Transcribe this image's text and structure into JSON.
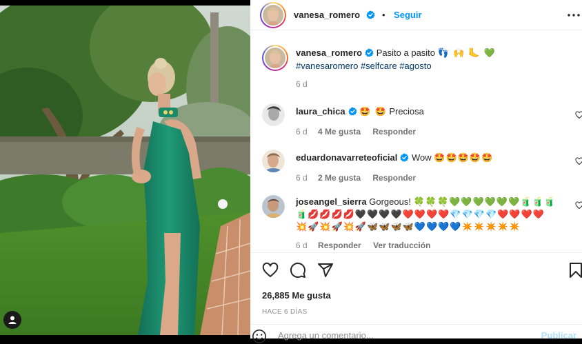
{
  "post": {
    "author": "vanesa_romero",
    "follow_label": "Seguir",
    "dot": "•",
    "caption_text": "Pasito a pasito",
    "caption_emojis": "👣 🙌 🦶 💚",
    "hashtags": "#vanesaromero #selfcare #agosto",
    "caption_age": "6 d"
  },
  "comments": [
    {
      "user": "laura_chica",
      "emojis": "🤩 🤩",
      "text": "Preciosa",
      "age": "6 d",
      "likes": "4 Me gusta",
      "reply": "Responder"
    },
    {
      "user": "eduardonavarreteoficial",
      "text": "Wow",
      "emojis": "🤩🤩🤩🤩🤩",
      "age": "6 d",
      "likes": "2 Me gusta",
      "reply": "Responder"
    },
    {
      "user": "joseangel_sierra",
      "text": "Gorgeous!",
      "line1_emojis": "🍀🍀🍀💚💚💚💚💚💚🧃🧃🧃",
      "line2_emojis": "🧃💋💋💋💋🖤🖤🖤🖤❤️❤️❤️❤️💎💎💎💎❤️❤️❤️❤️",
      "line3_emojis": "💥🚀💥🚀💥🚀🦋🦋🦋🦋💙💙💙💙✴️✴️✴️✴️✴️",
      "age": "6 d",
      "reply": "Responder",
      "translate": "Ver traducción"
    }
  ],
  "actions": {
    "likes": "26,885 Me gusta",
    "date": "HACE 6 DÍAS",
    "comment_placeholder": "Agrega un comentario...",
    "publish": "Publicar"
  },
  "colors": {
    "link": "#0095f6",
    "hashtag": "#00376b",
    "muted": "#8e8e8e",
    "dress": "#1f8f6d"
  }
}
